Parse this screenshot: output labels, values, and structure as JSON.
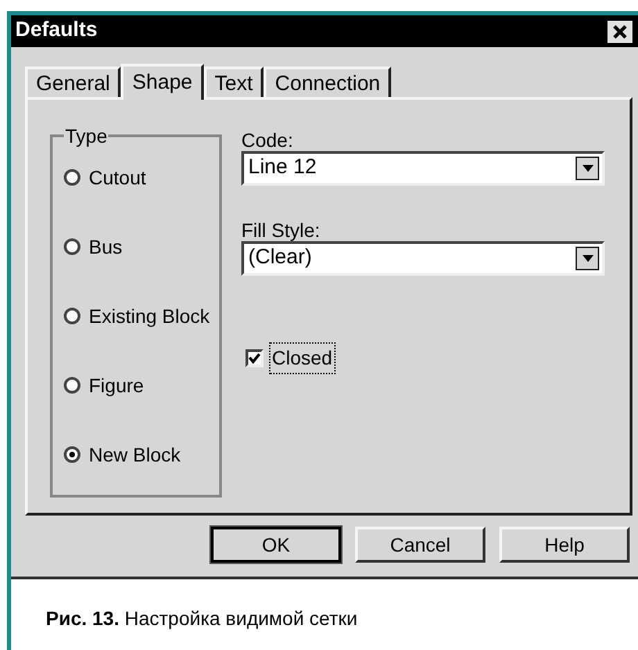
{
  "window": {
    "title": "Defaults"
  },
  "tabs": [
    {
      "label": "General",
      "selected": false
    },
    {
      "label": "Shape",
      "selected": true
    },
    {
      "label": "Text",
      "selected": false
    },
    {
      "label": "Connection",
      "selected": false
    }
  ],
  "type_group": {
    "label": "Type",
    "options": [
      {
        "label": "Cutout",
        "selected": false
      },
      {
        "label": "Bus",
        "selected": false
      },
      {
        "label": "Existing Block",
        "selected": false
      },
      {
        "label": "Figure",
        "selected": false
      },
      {
        "label": "New Block",
        "selected": true
      }
    ]
  },
  "code": {
    "label": "Code:",
    "value": "Line 12"
  },
  "fill_style": {
    "label": "Fill Style:",
    "value": "(Clear)"
  },
  "closed": {
    "label": "Closed",
    "checked": true
  },
  "buttons": [
    {
      "label": "OK",
      "default": true
    },
    {
      "label": "Cancel",
      "default": false
    },
    {
      "label": "Help",
      "default": false
    }
  ],
  "caption": "**Рис. 13.** Настройка видимой сетки"
}
